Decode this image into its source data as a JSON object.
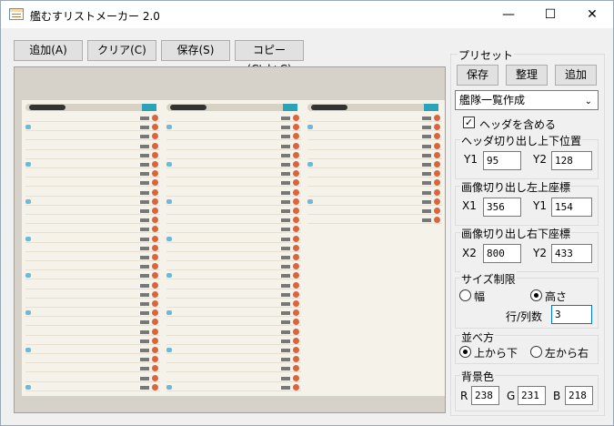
{
  "window": {
    "title": "艦むすリストメーカー 2.0",
    "min": "—",
    "max": "☐",
    "close": "✕"
  },
  "toolbar": {
    "add": "追加(A)",
    "clear": "クリア(C)",
    "save": "保存(S)",
    "copy": "コピー(Ctrl+C)"
  },
  "preset": {
    "label": "プリセット",
    "save": "保存",
    "organize": "整理",
    "add": "追加",
    "selected": "艦隊一覧作成",
    "include_header": "ヘッダを含める",
    "include_header_checked": true
  },
  "header_crop": {
    "label": "ヘッダ切り出し上下位置",
    "y1_label": "Y1",
    "y1": "95",
    "y2_label": "Y2",
    "y2": "128"
  },
  "crop_top_left": {
    "label": "画像切り出し左上座標",
    "x1_label": "X1",
    "x1": "356",
    "y1_label": "Y1",
    "y1": "154"
  },
  "crop_bottom_right": {
    "label": "画像切り出し右下座標",
    "x2_label": "X2",
    "x2": "800",
    "y2_label": "Y2",
    "y2": "433"
  },
  "size_limit": {
    "label": "サイズ制限",
    "width": "幅",
    "height": "高さ",
    "selected": "height",
    "rows_label": "行/列数",
    "rows": "3"
  },
  "arrange": {
    "label": "並べ方",
    "top_to_bottom": "上から下",
    "left_to_right": "左から右",
    "selected": "top_to_bottom"
  },
  "background": {
    "label": "背景色",
    "r_label": "R",
    "r": "238",
    "g_label": "G",
    "g": "231",
    "b_label": "B",
    "b": "218"
  }
}
